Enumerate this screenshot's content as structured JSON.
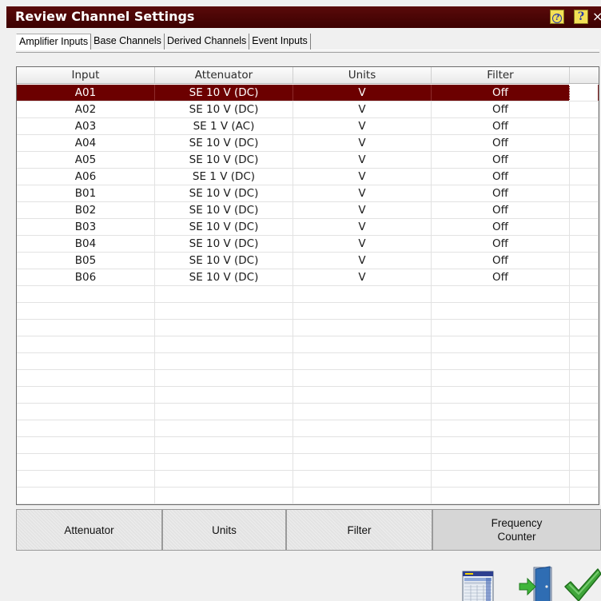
{
  "window": {
    "title": "Review Channel Settings",
    "close_glyph": "×",
    "hint_glyph": "?",
    "help_glyph": "?"
  },
  "tabs": [
    {
      "label": "Amplifier Inputs",
      "selected": true
    },
    {
      "label": "Base Channels",
      "selected": false
    },
    {
      "label": "Derived Channels",
      "selected": false
    },
    {
      "label": "Event Inputs",
      "selected": false
    }
  ],
  "table": {
    "columns": [
      "Input",
      "Attenuator",
      "Units",
      "Filter"
    ],
    "rows": [
      {
        "input": "A01",
        "attenuator": "SE 10 V (DC)",
        "units": "V",
        "filter": "Off",
        "selected": true
      },
      {
        "input": "A02",
        "attenuator": "SE 10 V (DC)",
        "units": "V",
        "filter": "Off"
      },
      {
        "input": "A03",
        "attenuator": "SE 1 V (AC)",
        "units": "V",
        "filter": "Off"
      },
      {
        "input": "A04",
        "attenuator": "SE 10 V (DC)",
        "units": "V",
        "filter": "Off"
      },
      {
        "input": "A05",
        "attenuator": "SE 10 V (DC)",
        "units": "V",
        "filter": "Off"
      },
      {
        "input": "A06",
        "attenuator": "SE 1 V (DC)",
        "units": "V",
        "filter": "Off"
      },
      {
        "input": "B01",
        "attenuator": "SE 10 V (DC)",
        "units": "V",
        "filter": "Off"
      },
      {
        "input": "B02",
        "attenuator": "SE 10 V (DC)",
        "units": "V",
        "filter": "Off"
      },
      {
        "input": "B03",
        "attenuator": "SE 10 V (DC)",
        "units": "V",
        "filter": "Off"
      },
      {
        "input": "B04",
        "attenuator": "SE 10 V (DC)",
        "units": "V",
        "filter": "Off"
      },
      {
        "input": "B05",
        "attenuator": "SE 10 V (DC)",
        "units": "V",
        "filter": "Off"
      },
      {
        "input": "B06",
        "attenuator": "SE 10 V (DC)",
        "units": "V",
        "filter": "Off"
      }
    ]
  },
  "buttons": {
    "attenuator": "Attenuator",
    "units": "Units",
    "filter": "Filter",
    "frequency_counter_line1": "Frequency",
    "frequency_counter_line2": "Counter"
  },
  "colors": {
    "titlebar": "#4a0505",
    "selection": "#6c0000",
    "help_button": "#f3df56",
    "ok_check": "#3fa63a",
    "exit_door": "#2f6db3"
  },
  "icons": [
    "hint-icon",
    "help-icon",
    "close-icon",
    "spreadsheet-icon",
    "exit-door-icon",
    "ok-checkmark-icon"
  ]
}
